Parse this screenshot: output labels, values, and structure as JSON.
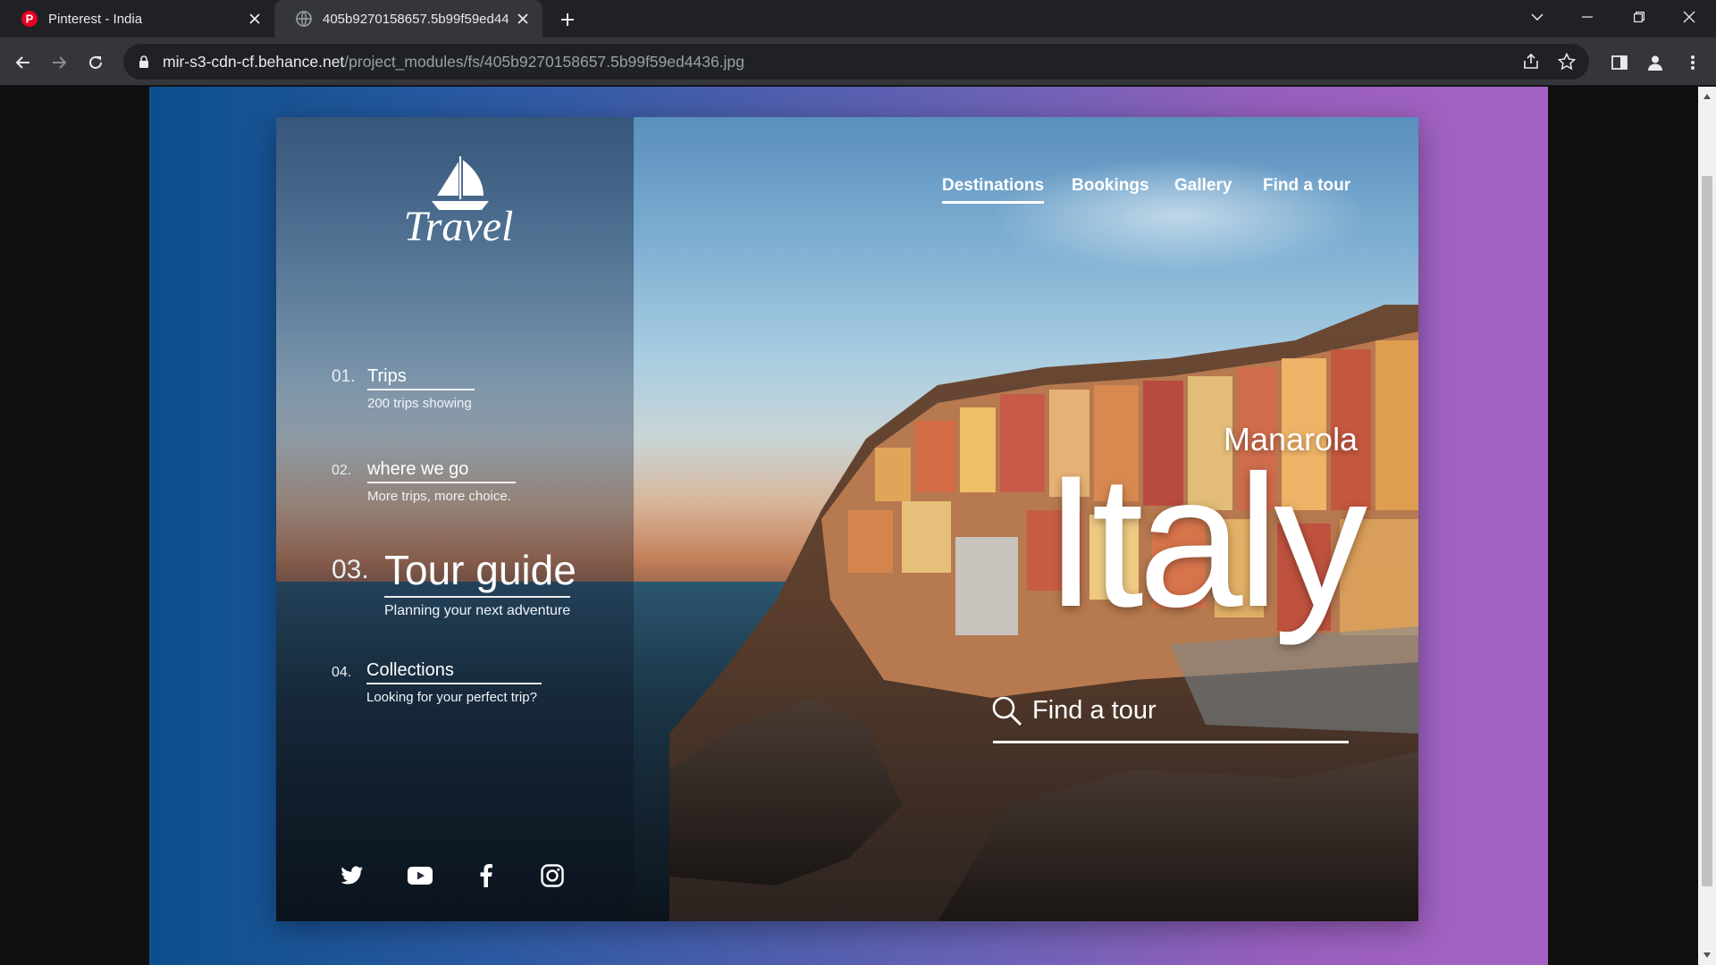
{
  "browser": {
    "tabs": [
      {
        "title": "Pinterest - India",
        "active": false
      },
      {
        "title": "405b9270158657.5b99f59ed4436.jpg",
        "active": true
      }
    ],
    "url_host": "mir-s3-cdn-cf.behance.net",
    "url_path": "/project_modules/fs/405b9270158657.5b99f59ed4436.jpg"
  },
  "page": {
    "logo_text": "Travel",
    "menu": [
      {
        "num": "01.",
        "title": "Trips",
        "subtitle": "200 trips showing"
      },
      {
        "num": "02.",
        "title": "where we go",
        "subtitle": "More trips, more choice."
      },
      {
        "num": "03.",
        "title": "Tour guide",
        "subtitle": "Planning your next adventure"
      },
      {
        "num": "04.",
        "title": "Collections",
        "subtitle": "Looking for your perfect trip?"
      }
    ],
    "nav": [
      "Destinations",
      "Bookings",
      "Gallery",
      "Find a tour"
    ],
    "active_nav": "Destinations",
    "city": "Manarola",
    "country": "Italy",
    "search_placeholder": "Find a tour",
    "social": [
      "twitter-icon",
      "youtube-icon",
      "facebook-icon",
      "instagram-icon"
    ]
  },
  "colors": {
    "gradient_left": "#0c4f8d",
    "gradient_right": "#a463c2",
    "chrome_dark": "#202124",
    "chrome_toolbar": "#35363a"
  }
}
